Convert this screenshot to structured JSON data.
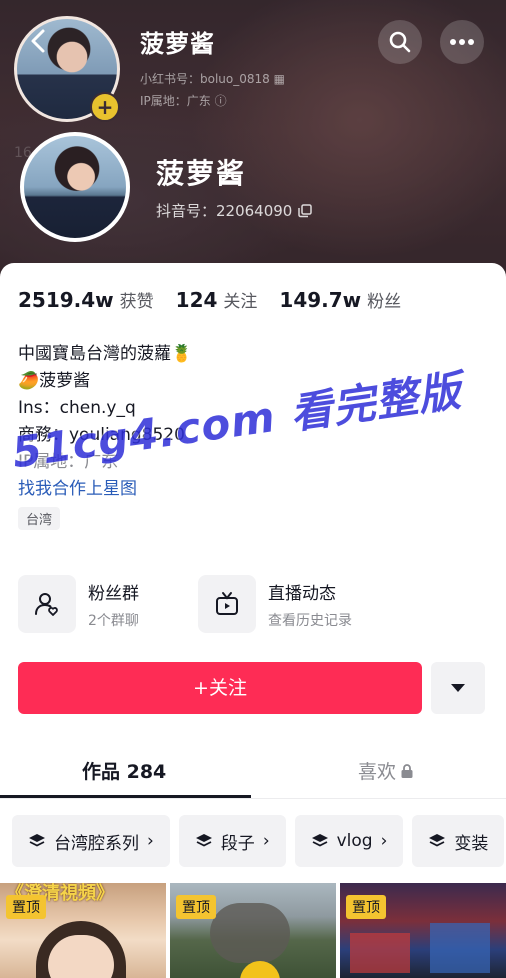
{
  "profile": {
    "name": "菠萝酱",
    "ghost_name": "菠萝酱",
    "xiaohongshu_id": "小红书号：boluo_0818",
    "ghost_ip": "IP属地：广东",
    "douyin_id": "抖音号：22064090"
  },
  "stats": [
    {
      "num": "2519.4w",
      "label": "获赞"
    },
    {
      "num": "124",
      "label": "关注"
    },
    {
      "num": "149.7w",
      "label": "粉丝"
    }
  ],
  "bio": {
    "line1": "中國寶島台灣的菠蘿🍍",
    "line2": "🥭菠萝酱",
    "line3": "Ins：chen.y_q",
    "line4": "商務：youliang8520",
    "ip": "IP属地：广东",
    "link": "找我合作上星图",
    "tag": "台湾"
  },
  "watermark": "51cg4.com 看完整版",
  "entries": [
    {
      "title": "粉丝群",
      "sub": "2个群聊"
    },
    {
      "title": "直播动态",
      "sub": "查看历史记录"
    }
  ],
  "actions": {
    "follow": "+关注"
  },
  "tabs": {
    "works": "作品 284",
    "likes": "喜欢"
  },
  "chips": [
    "台湾腔系列",
    "段子",
    "vlog",
    "变装"
  ],
  "thumbs": [
    {
      "pin": "置顶",
      "caption": "《澄清視頻》"
    },
    {
      "pin": "置顶",
      "caption": ""
    },
    {
      "pin": "置顶",
      "caption": ""
    }
  ],
  "colors": {
    "accent": "#fe2c55",
    "pin": "#f4c430",
    "link": "#2a5cb8"
  }
}
